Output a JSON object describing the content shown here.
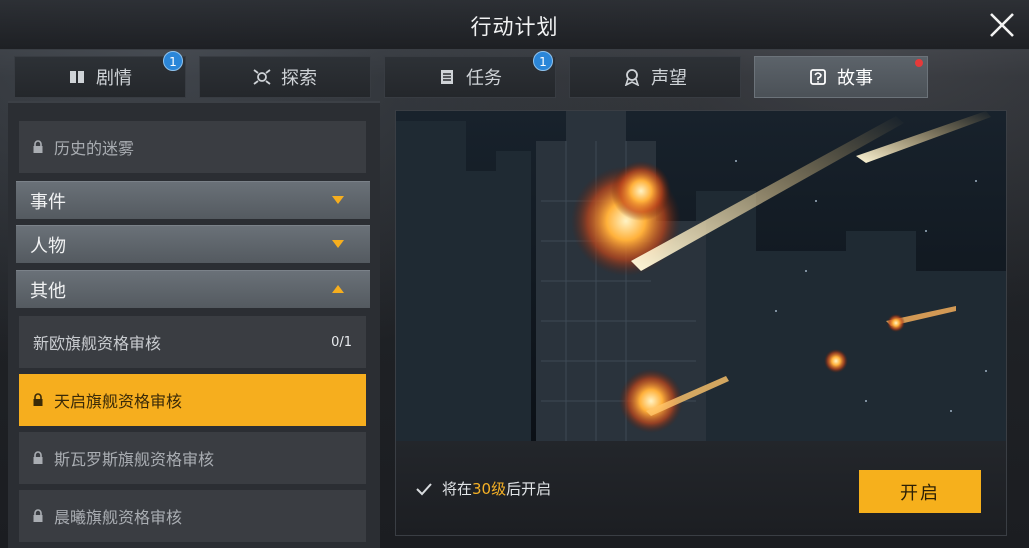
{
  "window": {
    "title": "行动计划"
  },
  "tabs": [
    {
      "label": "剧情",
      "icon": "book-icon",
      "badge": "1"
    },
    {
      "label": "探索",
      "icon": "explore-icon"
    },
    {
      "label": "任务",
      "icon": "clipboard-icon",
      "badge": "1"
    },
    {
      "label": "声望",
      "icon": "medal-icon"
    },
    {
      "label": "故事",
      "icon": "story-icon",
      "active": true,
      "notification_dot": true
    }
  ],
  "sidebar": {
    "top_item": {
      "label": "历史的迷雾",
      "locked": true
    },
    "categories": [
      {
        "label": "事件",
        "expanded": false
      },
      {
        "label": "人物",
        "expanded": false
      },
      {
        "label": "其他",
        "expanded": true
      }
    ],
    "items": [
      {
        "label": "新欧旗舰资格审核",
        "count": "0/1",
        "locked": false
      },
      {
        "label": "天启旗舰资格审核",
        "locked": true,
        "selected": true
      },
      {
        "label": "斯瓦罗斯旗舰资格审核",
        "locked": true
      },
      {
        "label": "晨曦旗舰资格审核",
        "locked": true
      }
    ]
  },
  "detail": {
    "unlock_prefix": "将在",
    "unlock_level": "30级",
    "unlock_suffix": "后开启",
    "open_button": "开启"
  },
  "colors": {
    "accent": "#f6ae1e",
    "badge_blue": "#2b86d8",
    "dot_red": "#e53a3a",
    "category_bg": "#5f666c"
  }
}
